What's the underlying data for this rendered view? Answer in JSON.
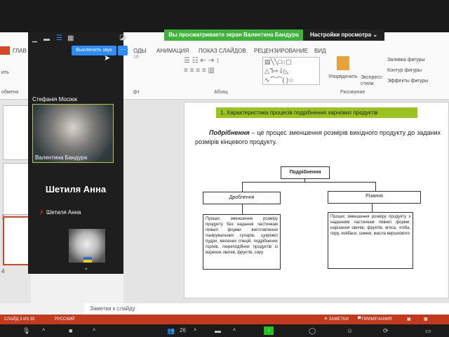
{
  "zoom": {
    "banner": "Вы просматриваете экран Валентина Бандура",
    "view_settings": "Настройки просмотра ⌄",
    "unmute_button": "Выключить звук",
    "more_button": "···",
    "participants": [
      {
        "name": "Стефанія Мосіюк"
      },
      {
        "name": "Валентина Бандура"
      },
      {
        "name": "Шетиля Анна"
      }
    ],
    "big_name": "Шетиля Анна",
    "participant_count": "26",
    "expand": "⌄"
  },
  "ppt": {
    "tabs": [
      "ГЛАВ",
      "ОДЫ",
      "АНИМАЦИЯ",
      "ПОКАЗ СЛАЙДОВ",
      "РЕЦЕНЗИРОВАНИЕ",
      "ВИД"
    ],
    "groups": [
      "обмена",
      "фт",
      "Абзац",
      "Рисование"
    ],
    "ribbon": {
      "arrange": "Упорядочить",
      "quick_styles": "Экспресс-стили",
      "fill": "Заливка фигуры",
      "outline": "Контур фигуры",
      "effects": "Эффекты фигуры",
      "font_size": "18",
      "paste": "ить"
    },
    "slide": {
      "title": "1. Характеристика процесів подрібнення харчових продуктів",
      "term": "Подрібнення",
      "definition": " – це процес зменшення розмірів вихідного продукту до заданих розмірів кінцевого продукту.",
      "root": "Подрібнення",
      "left_head": "Дроблення",
      "right_head": "Різання",
      "left_text": "Процес зменшення розміру продукту без надання частинкам певної форми: виготовлення панірувальних сухарів, цукрової пудри, мелених спецій, подрібнених горіхів, пюреподібних продуктів із варених овочів, фруктів, сиру",
      "right_text": "Процес зменшення розміру продукту з наданням частинкам певної форми: нарізання овочів, фруктів, м'яса, хліба, сиру, ковбаси, шинки, масла вершкового"
    },
    "thumb_numbers": [
      "3",
      "4"
    ],
    "notes_placeholder": "Заметки к слайду",
    "status": {
      "slide": "СЛАЙД 3 ИЗ 33",
      "language": "РУССКИЙ",
      "notes": "≙ ЗАМЕТКИ",
      "comments": "▀ ПРИМЕЧАНИЯ"
    }
  }
}
